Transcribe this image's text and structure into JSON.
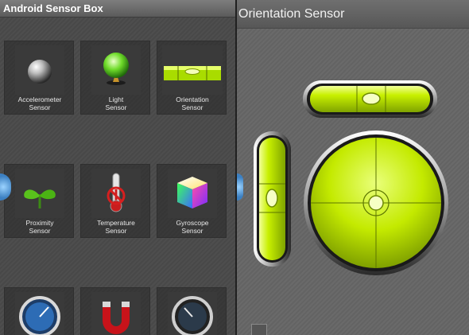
{
  "left_app": {
    "title": "Android Sensor Box",
    "tiles": [
      {
        "label": "Accelerometer\nSensor",
        "icon": "metal-ball-icon"
      },
      {
        "label": "Light\nSensor",
        "icon": "light-bulb-icon"
      },
      {
        "label": "Orientation\nSensor",
        "icon": "spirit-level-icon"
      },
      {
        "label": "Proximity\nSensor",
        "icon": "sprout-icon"
      },
      {
        "label": "Temperature\nSensor",
        "icon": "thermometer-icon"
      },
      {
        "label": "Gyroscope\nSensor",
        "icon": "color-cube-icon"
      },
      {
        "label": "",
        "icon": "gauge-icon"
      },
      {
        "label": "",
        "icon": "magnet-icon"
      },
      {
        "label": "",
        "icon": "speedometer-icon"
      }
    ]
  },
  "right_app": {
    "title": "Orientation Sensor",
    "horizontal_level": 0.5,
    "vertical_level": 0.5,
    "bubble_x": 0.5,
    "bubble_y": 0.5
  },
  "colors": {
    "level_green": "#c8f000",
    "accent_blue": "#3c80c2"
  }
}
